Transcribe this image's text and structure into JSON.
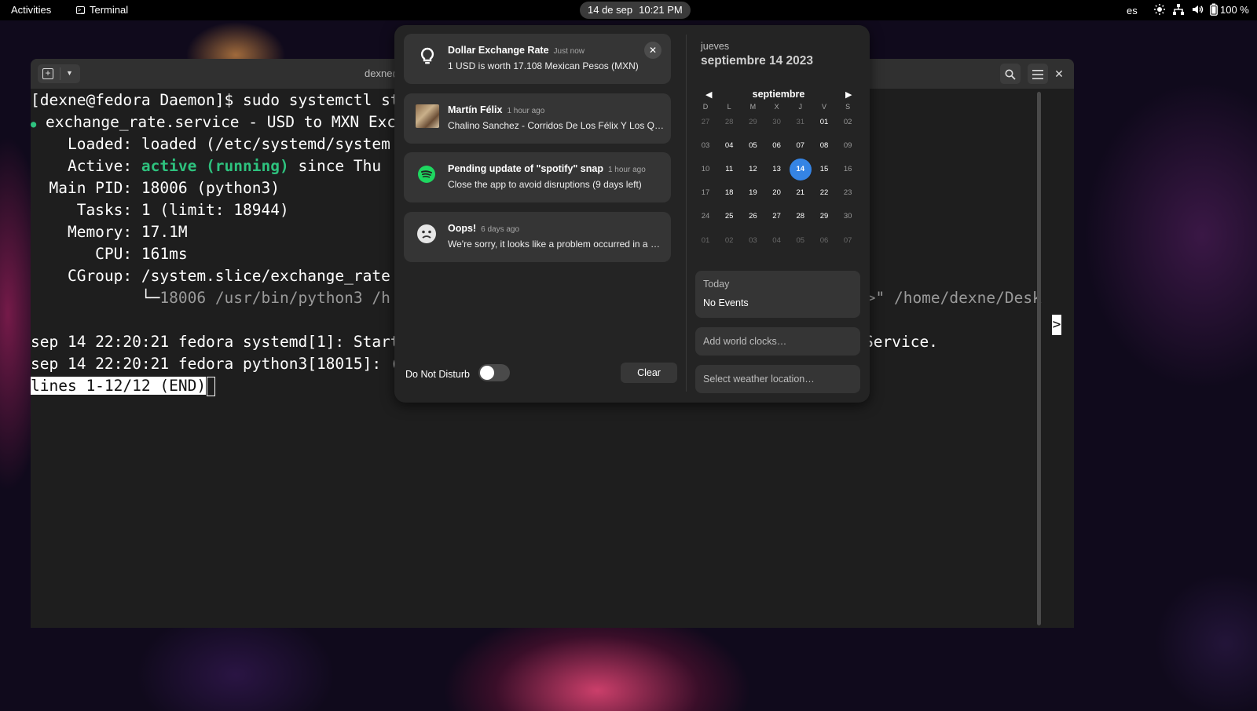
{
  "topbar": {
    "activities": "Activities",
    "app_name": "Terminal",
    "app_icon_glyph": ">_",
    "date": "14 de sep",
    "time": "10:21 PM",
    "language": "es",
    "battery": "100 %",
    "icons": [
      "brightness-icon",
      "network-icon",
      "volume-icon",
      "battery-icon"
    ]
  },
  "terminal": {
    "title": "dexne@fedora",
    "lines": {
      "l1": "[dexne@fedora Daemon]$ sudo systemctl st",
      "l2_bullet": "●",
      "l2": " exchange_rate.service - USD to MXN Exc",
      "l3": "    Loaded: loaded (/etc/systemd/system",
      "l4_prefix": "    Active: ",
      "l4_status": "active (running)",
      "l4_suffix": " since Thu",
      "l5": "  Main PID: 18006 (python3)",
      "l6": "     Tasks: 1 (limit: 18944)",
      "l7": "    Memory: 17.1M",
      "l8": "       CPU: 161ms",
      "l9": "    CGroup: /system.slice/exchange_rate",
      "l10_tree": "            └─",
      "l10": "18006 /usr/bin/python3 /h",
      "l10_right": ">>\" /home/dexne/Desk",
      "l11": "sep 14 22:20:21 fedora systemd[1]: Start",
      "l11_right": "Service.",
      "l12": "sep 14 22:20:21 fedora python3[18015]: (",
      "pager": "lines 1-12/12 (END)",
      "scroll_marker": ">"
    }
  },
  "notifications": [
    {
      "title": "Dollar Exchange Rate",
      "time": "Just now",
      "body": "1 USD is worth 17.108 Mexican Pesos (MXN)",
      "icon": "lightbulb-icon"
    },
    {
      "title": "Martín Félix",
      "time": "1 hour ago",
      "body": "Chalino Sanchez - Corridos De Los Félix Y Los Qu…",
      "icon": "album-art-icon"
    },
    {
      "title": "Pending update of \"spotify\" snap",
      "time": "1 hour ago",
      "body": "Close the app to avoid disruptions (9 days left)",
      "icon": "spotify-icon"
    },
    {
      "title": "Oops!",
      "time": "6 days ago",
      "body": "We're sorry, it looks like a problem occurred in a …",
      "icon": "sad-face-icon"
    }
  ],
  "tray": {
    "dnd_label": "Do Not Disturb",
    "dnd_on": false,
    "clear_label": "Clear"
  },
  "calendar": {
    "weekday": "jueves",
    "full_date": "septiembre 14 2023",
    "month": "septiembre",
    "weekday_headers": [
      "D",
      "L",
      "M",
      "X",
      "J",
      "V",
      "S"
    ],
    "weeks": [
      [
        "27",
        "28",
        "29",
        "30",
        "31",
        "01",
        "02"
      ],
      [
        "03",
        "04",
        "05",
        "06",
        "07",
        "08",
        "09"
      ],
      [
        "10",
        "11",
        "12",
        "13",
        "14",
        "15",
        "16"
      ],
      [
        "17",
        "18",
        "19",
        "20",
        "21",
        "22",
        "23"
      ],
      [
        "24",
        "25",
        "26",
        "27",
        "28",
        "29",
        "30"
      ],
      [
        "01",
        "02",
        "03",
        "04",
        "05",
        "06",
        "07"
      ]
    ],
    "today_value": "14",
    "today_label": "Today",
    "no_events": "No Events",
    "world_clocks": "Add world clocks…",
    "weather": "Select weather location…"
  }
}
